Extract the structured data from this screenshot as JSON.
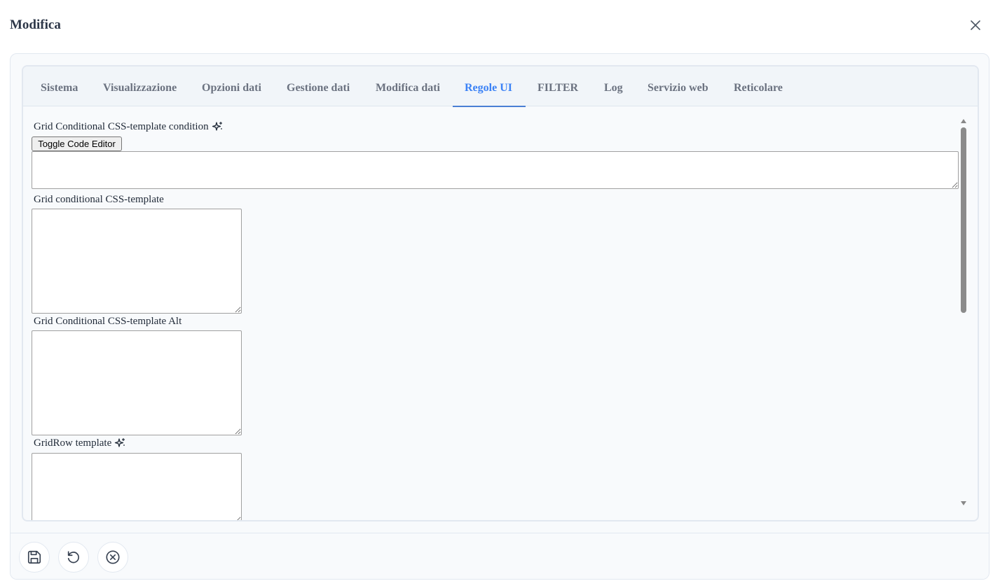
{
  "dialog": {
    "title": "Modifica",
    "close_icon": "close-icon"
  },
  "tabs": [
    {
      "label": "Sistema",
      "active": false
    },
    {
      "label": "Visualizzazione",
      "active": false
    },
    {
      "label": "Opzioni dati",
      "active": false
    },
    {
      "label": "Gestione dati",
      "active": false
    },
    {
      "label": "Modifica dati",
      "active": false
    },
    {
      "label": "Regole UI",
      "active": true
    },
    {
      "label": "FILTER",
      "active": false
    },
    {
      "label": "Log",
      "active": false
    },
    {
      "label": "Servizio web",
      "active": false
    },
    {
      "label": "Reticolare",
      "active": false
    }
  ],
  "fields": {
    "css_condition": {
      "label": "Grid Conditional CSS-template condition",
      "value": "",
      "icon": "sparkle-icon"
    },
    "toggle_editor_label": "Toggle Code Editor",
    "css_template": {
      "label": "Grid conditional CSS-template",
      "value": ""
    },
    "css_template_alt": {
      "label": "Grid Conditional CSS-template Alt",
      "value": ""
    },
    "gridrow_template": {
      "label": "GridRow template",
      "value": "",
      "icon": "sparkle-icon"
    }
  },
  "footer": {
    "buttons": [
      {
        "name": "save-button",
        "icon": "save-icon"
      },
      {
        "name": "reset-button",
        "icon": "undo-icon"
      },
      {
        "name": "cancel-button",
        "icon": "cancel-circle-icon"
      }
    ]
  },
  "colors": {
    "accent": "#3b82f6",
    "tab_inactive": "#6b7280",
    "panel_bg": "#f8fafc",
    "border": "#e2e8f0"
  }
}
